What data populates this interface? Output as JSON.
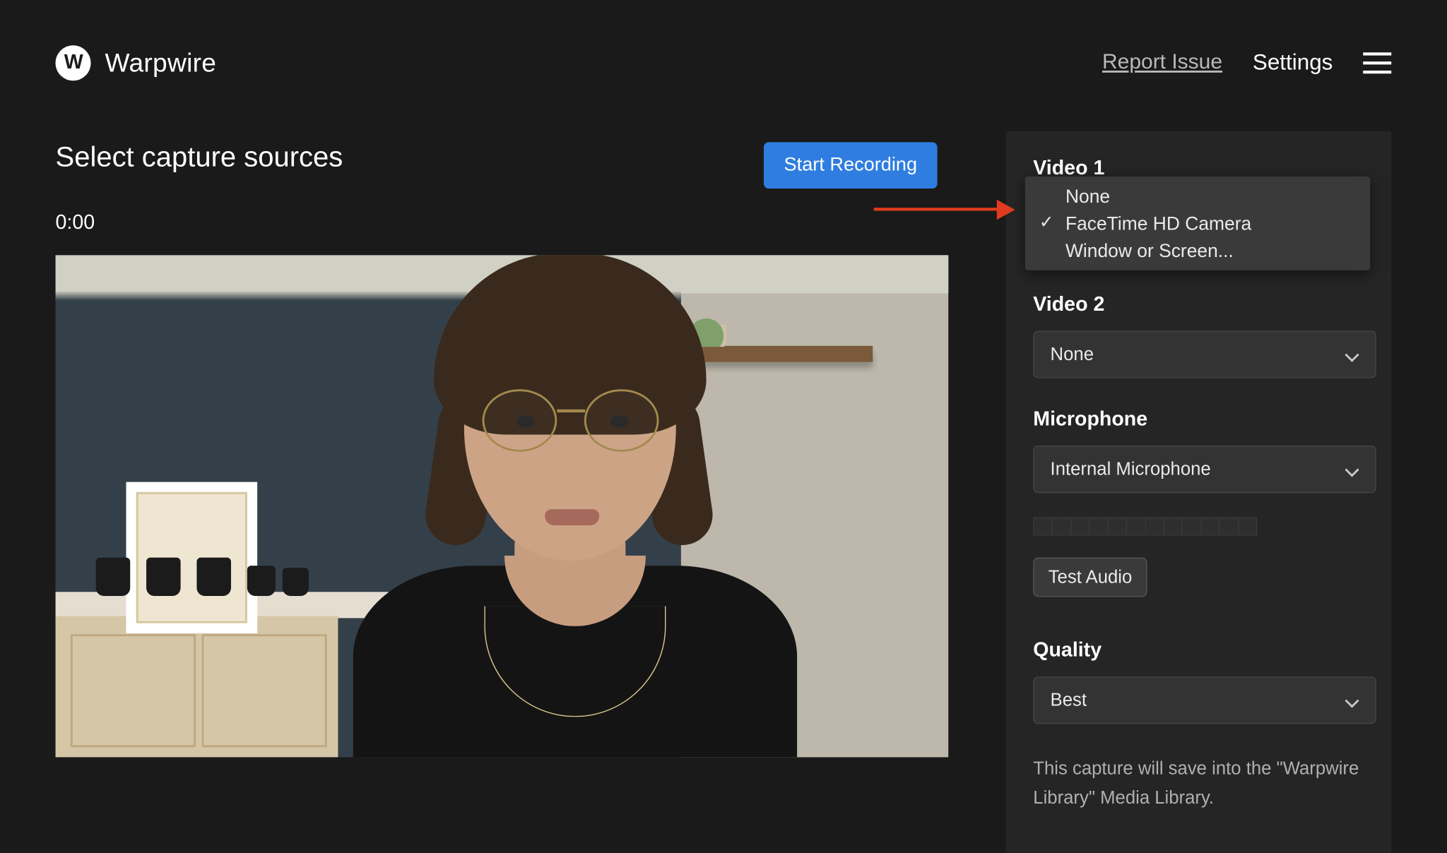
{
  "brand": {
    "logo_letter": "W",
    "name": "Warpwire"
  },
  "top": {
    "report": "Report Issue",
    "settings": "Settings"
  },
  "page": {
    "title": "Select capture sources",
    "timer": "0:00",
    "start_label": "Start Recording"
  },
  "video1": {
    "label": "Video 1",
    "options": [
      "None",
      "FaceTime HD Camera",
      "Window or Screen..."
    ],
    "selected_index": 1
  },
  "video2": {
    "label": "Video 2",
    "value": "None"
  },
  "microphone": {
    "label": "Microphone",
    "value": "Internal Microphone"
  },
  "test_audio": "Test Audio",
  "quality": {
    "label": "Quality",
    "value": "Best"
  },
  "hint": "This capture will save into the \"Warpwire Library\" Media Library."
}
